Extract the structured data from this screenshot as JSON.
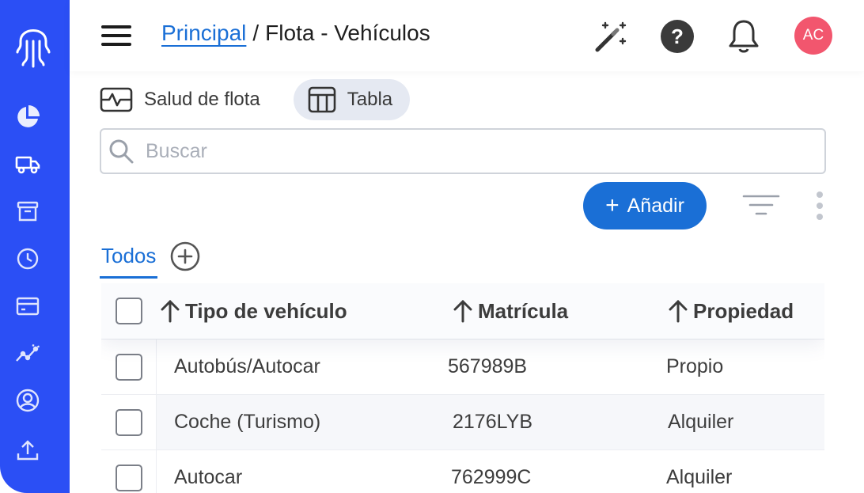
{
  "app": {
    "avatar_initials": "AC",
    "colors": {
      "sidebar": "#2b4ff5",
      "accent": "#1a6fd6",
      "avatar": "#f2566e"
    }
  },
  "sidebar": {
    "logo": "octopus-logo",
    "items": [
      {
        "icon": "pie-chart-icon"
      },
      {
        "icon": "truck-icon"
      },
      {
        "icon": "archive-icon"
      },
      {
        "icon": "clock-icon"
      },
      {
        "icon": "credit-card-icon"
      },
      {
        "icon": "trend-chart-icon"
      },
      {
        "icon": "user-circle-icon"
      },
      {
        "icon": "upload-icon"
      }
    ]
  },
  "header": {
    "breadcrumb_link": "Principal",
    "breadcrumb_sep": "/",
    "breadcrumb_current": "Flota - Vehículos"
  },
  "view_tabs": [
    {
      "label": "Salud de flota",
      "icon": "pulse-icon",
      "active": false
    },
    {
      "label": "Tabla",
      "icon": "table-icon",
      "active": true
    }
  ],
  "search": {
    "placeholder": "Buscar",
    "value": ""
  },
  "toolbar": {
    "add_label": "Añadir"
  },
  "list_tabs": {
    "active_label": "Todos"
  },
  "table": {
    "columns": [
      "Tipo de vehículo",
      "Matrícula",
      "Propiedad"
    ],
    "rows": [
      [
        "Autobús/Autocar",
        "567989B",
        "Propio"
      ],
      [
        "Coche (Turismo)",
        "2176LYB",
        "Alquiler"
      ],
      [
        "Autocar",
        "762999C",
        "Alquiler"
      ]
    ]
  }
}
